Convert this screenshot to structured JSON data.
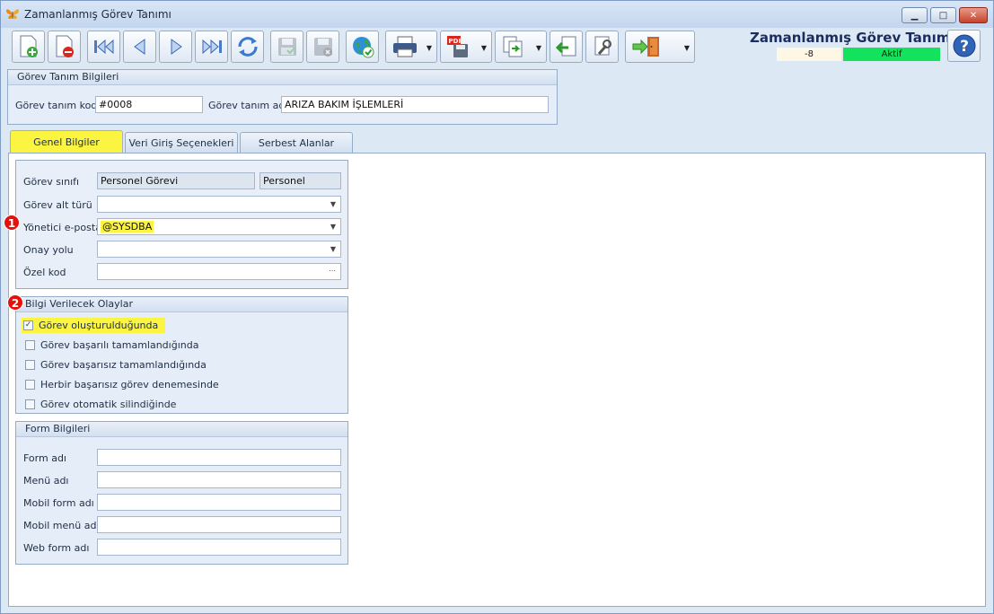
{
  "window": {
    "title": "Zamanlanmış Görev Tanımı",
    "controls": {
      "minimize": "▁",
      "maximize": "□",
      "close": "✕"
    }
  },
  "toolbar": {
    "buttons": [
      {
        "name": "new-document-icon"
      },
      {
        "name": "delete-document-icon"
      },
      {
        "name": "first-record-icon"
      },
      {
        "name": "previous-record-icon"
      },
      {
        "name": "next-record-icon"
      },
      {
        "name": "last-record-icon"
      },
      {
        "name": "refresh-icon"
      },
      {
        "name": "save-icon"
      },
      {
        "name": "save-close-icon"
      },
      {
        "name": "globe-check-icon"
      },
      {
        "name": "printer-icon"
      },
      {
        "name": "pdf-export-icon"
      },
      {
        "name": "copy-document-icon"
      },
      {
        "name": "import-icon"
      },
      {
        "name": "tools-icon"
      },
      {
        "name": "exit-door-icon"
      }
    ],
    "caret": "▼"
  },
  "header": {
    "form_title": "Zamanlanmış Görev Tanımı",
    "record_number": "-8",
    "status": "Aktif",
    "status_color": "#13e35c",
    "help": "?"
  },
  "definition": {
    "group_title": "Görev Tanım Bilgileri",
    "code_label": "Görev tanım kodu",
    "code_value": "#0008",
    "name_label": "Görev tanım adı",
    "name_value": "ARIZA BAKIM İŞLEMLERİ"
  },
  "tabs": [
    {
      "label": "Genel Bilgiler",
      "active": true
    },
    {
      "label": "Veri Giriş Seçenekleri",
      "active": false
    },
    {
      "label": "Serbest Alanlar",
      "active": false
    }
  ],
  "general": {
    "class_label": "Görev sınıfı",
    "class_value": "Personel Görevi",
    "class_extra": "Personel",
    "subtype_label": "Görev alt türü",
    "subtype_value": "",
    "manager_email_label": "Yönetici e-posta",
    "manager_email_value": "@SYSDBA",
    "approval_label": "Onay yolu",
    "approval_value": "",
    "special_code_label": "Özel kod",
    "special_code_value": "",
    "ellipsis": "..."
  },
  "events": {
    "group_title": "Bilgi Verilecek Olaylar",
    "items": [
      {
        "label": "Görev oluşturulduğunda",
        "checked": true
      },
      {
        "label": "Görev başarılı tamamlandığında",
        "checked": false
      },
      {
        "label": "Görev başarısız tamamlandığında",
        "checked": false
      },
      {
        "label": "Herbir başarısız görev denemesinde",
        "checked": false
      },
      {
        "label": "Görev otomatik silindiğinde",
        "checked": false
      }
    ],
    "check_mark": "✓"
  },
  "form_info": {
    "group_title": "Form Bilgileri",
    "fields": [
      {
        "label": "Form adı",
        "value": ""
      },
      {
        "label": "Menü adı",
        "value": ""
      },
      {
        "label": "Mobil form adı",
        "value": ""
      },
      {
        "label": "Mobil menü adı",
        "value": ""
      },
      {
        "label": "Web form adı",
        "value": ""
      }
    ]
  },
  "annotations": {
    "badge_1": "1",
    "badge_2": "2"
  },
  "colors": {
    "highlight": "#fbf542",
    "badge": "#e3120b"
  }
}
